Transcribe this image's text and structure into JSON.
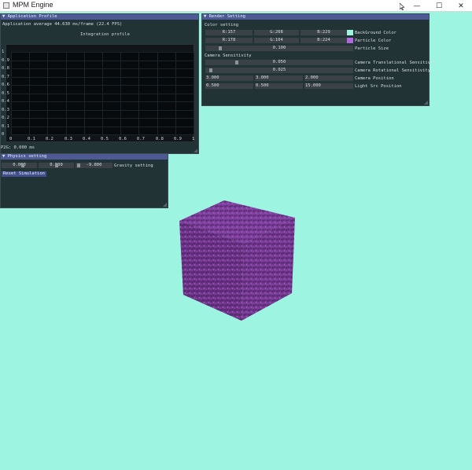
{
  "window": {
    "title": "MPM Engine",
    "minimize": "—",
    "maximize": "☐",
    "close": "✕"
  },
  "app_profile": {
    "header": "▼ Application Profile",
    "average": "Application average 44.630 ms/frame (22.4 FPS)",
    "chart_title": "Integration profile",
    "footer": "P2G: 0.000 ms"
  },
  "chart_data": {
    "type": "line",
    "title": "Integration profile",
    "x_ticks": [
      "0",
      "0.1",
      "0.2",
      "0.3",
      "0.4",
      "0.5",
      "0.6",
      "0.7",
      "0.8",
      "0.9",
      "1"
    ],
    "y_ticks": [
      "1",
      "0.9",
      "0.8",
      "0.7",
      "0.6",
      "0.5",
      "0.4",
      "0.3",
      "0.2",
      "0.1",
      "0"
    ],
    "xlim": [
      0,
      1
    ],
    "ylim": [
      0,
      1
    ],
    "series": [],
    "grid": true
  },
  "render_setting": {
    "header": "▼ Render Setting",
    "color_setting": "Color setting",
    "bg_r": "R:157",
    "bg_g": "G:208",
    "bg_b": "B:229",
    "bg_label": "BackGround Color",
    "p_r": "R:178",
    "p_g": "G:104",
    "p_b": "B:224",
    "p_label": "Particle Color",
    "particle_size": "0.100",
    "particle_size_label": "Particle Size",
    "camera_sensitivity": "Camera Sensitivity",
    "trans_value": "0.050",
    "trans_label": "Camera Translational Sensitivit",
    "rot_value": "0.025",
    "rot_label": "Camera Rotational Sensitivity",
    "cam_x": "3.000",
    "cam_y": "3.000",
    "cam_z": "2.000",
    "cam_label": "Camera Position",
    "light_x": "0.500",
    "light_y": "0.500",
    "light_z": "15.000",
    "light_label": "Light Src Position",
    "bg_swatch": "#9df5e1",
    "particle_swatch": "#b268e0"
  },
  "physics": {
    "header": "▼ Physics setting",
    "gx": "0.000",
    "gy": "0.000",
    "gz": "-9.800",
    "gravity_label": "Gravity setting",
    "reset": "Reset Simulation"
  },
  "colors": {
    "background": "#9df5e1",
    "particle": "#7a3d95",
    "accent": "#4d5a95"
  }
}
